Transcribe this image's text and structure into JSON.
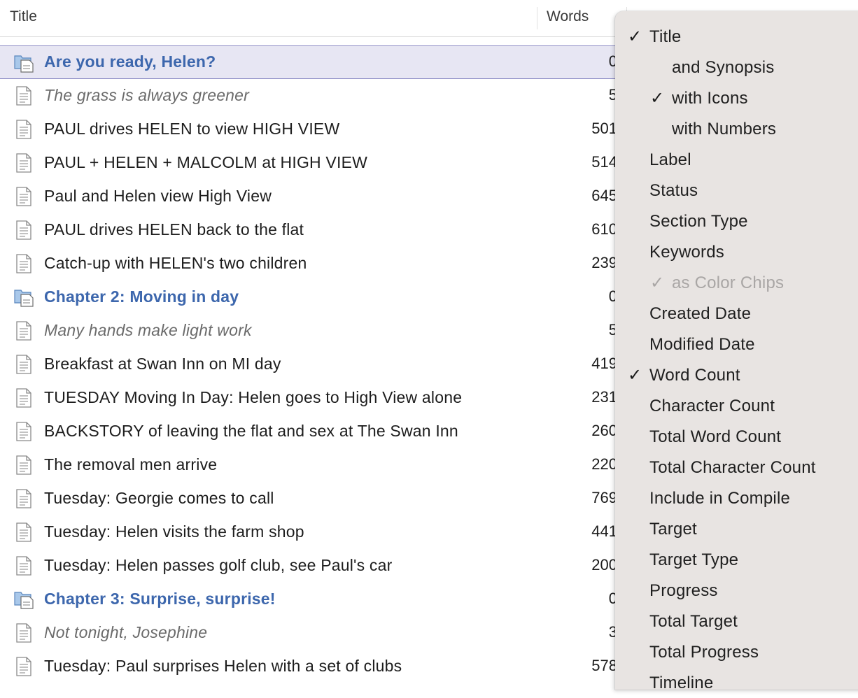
{
  "header": {
    "title_col": "Title",
    "words_col": "Words"
  },
  "rows": [
    {
      "title": "Are you ready, Helen?",
      "count": "0",
      "kind": "folder",
      "selected": true,
      "icon": "folder-doc-icon"
    },
    {
      "title": "The grass is always greener",
      "count": "5",
      "kind": "synopsis",
      "icon": "document-icon"
    },
    {
      "title": "PAUL drives HELEN to view HIGH VIEW",
      "count": "501",
      "kind": "doc",
      "icon": "document-icon"
    },
    {
      "title": "PAUL + HELEN + MALCOLM at HIGH VIEW",
      "count": "514",
      "kind": "doc",
      "icon": "document-icon"
    },
    {
      "title": "Paul and Helen view High View",
      "count": "645",
      "kind": "doc",
      "icon": "document-icon"
    },
    {
      "title": "PAUL drives HELEN back to the flat",
      "count": "610",
      "kind": "doc",
      "icon": "document-icon"
    },
    {
      "title": "Catch-up with HELEN's two children",
      "count": "239",
      "kind": "doc",
      "icon": "document-icon"
    },
    {
      "title": "Chapter 2: Moving in day",
      "count": "0",
      "kind": "folder",
      "icon": "folder-doc-icon"
    },
    {
      "title": "Many hands make light work",
      "count": "5",
      "kind": "synopsis",
      "icon": "document-icon"
    },
    {
      "title": "Breakfast at Swan Inn on MI day",
      "count": "419",
      "kind": "doc",
      "icon": "document-icon"
    },
    {
      "title": "TUESDAY Moving In Day: Helen goes to High View alone",
      "count": "231",
      "kind": "doc",
      "icon": "document-icon"
    },
    {
      "title": "BACKSTORY of leaving the flat and sex at The Swan Inn",
      "count": "260",
      "kind": "doc",
      "icon": "document-icon"
    },
    {
      "title": "The removal men arrive",
      "count": "220",
      "kind": "doc",
      "icon": "document-icon"
    },
    {
      "title": "Tuesday: Georgie comes to call",
      "count": "769",
      "kind": "doc",
      "icon": "document-icon"
    },
    {
      "title": "Tuesday: Helen visits the farm shop",
      "count": "441",
      "kind": "doc",
      "icon": "document-icon"
    },
    {
      "title": "Tuesday: Helen passes golf club, see Paul's car",
      "count": "200",
      "kind": "doc",
      "icon": "document-icon"
    },
    {
      "title": "Chapter 3: Surprise, surprise!",
      "count": "0",
      "kind": "folder",
      "icon": "folder-doc-icon"
    },
    {
      "title": "Not tonight, Josephine",
      "count": "3",
      "kind": "synopsis",
      "icon": "document-icon"
    },
    {
      "title": "Tuesday: Paul surprises Helen with a set of clubs",
      "count": "578",
      "kind": "doc",
      "icon": "document-icon"
    }
  ],
  "menu": {
    "check_glyph": "✓",
    "items": [
      {
        "label": "Title",
        "checked": true
      },
      {
        "label": "and Synopsis",
        "checked": false,
        "indent": true
      },
      {
        "label": "with Icons",
        "checked": true,
        "indent": true
      },
      {
        "label": "with Numbers",
        "checked": false,
        "indent": true
      },
      {
        "label": "Label",
        "checked": false
      },
      {
        "label": "Status",
        "checked": false
      },
      {
        "label": "Section Type",
        "checked": false
      },
      {
        "label": "Keywords",
        "checked": false
      },
      {
        "label": "as Color Chips",
        "checked": true,
        "indent": true,
        "disabled": true
      },
      {
        "label": "Created Date",
        "checked": false
      },
      {
        "label": "Modified Date",
        "checked": false
      },
      {
        "label": "Word Count",
        "checked": true
      },
      {
        "label": "Character Count",
        "checked": false
      },
      {
        "label": "Total Word Count",
        "checked": false
      },
      {
        "label": "Total Character Count",
        "checked": false
      },
      {
        "label": "Include in Compile",
        "checked": false
      },
      {
        "label": "Target",
        "checked": false
      },
      {
        "label": "Target Type",
        "checked": false
      },
      {
        "label": "Progress",
        "checked": false
      },
      {
        "label": "Total Target",
        "checked": false
      },
      {
        "label": "Total Progress",
        "checked": false
      },
      {
        "label": "Timeline",
        "checked": false
      }
    ]
  },
  "colors": {
    "folder_title": "#3d67ad",
    "selection_bg": "#e7e6f3",
    "selection_border": "#8a89c4",
    "menu_bg": "#e8e4e2"
  }
}
